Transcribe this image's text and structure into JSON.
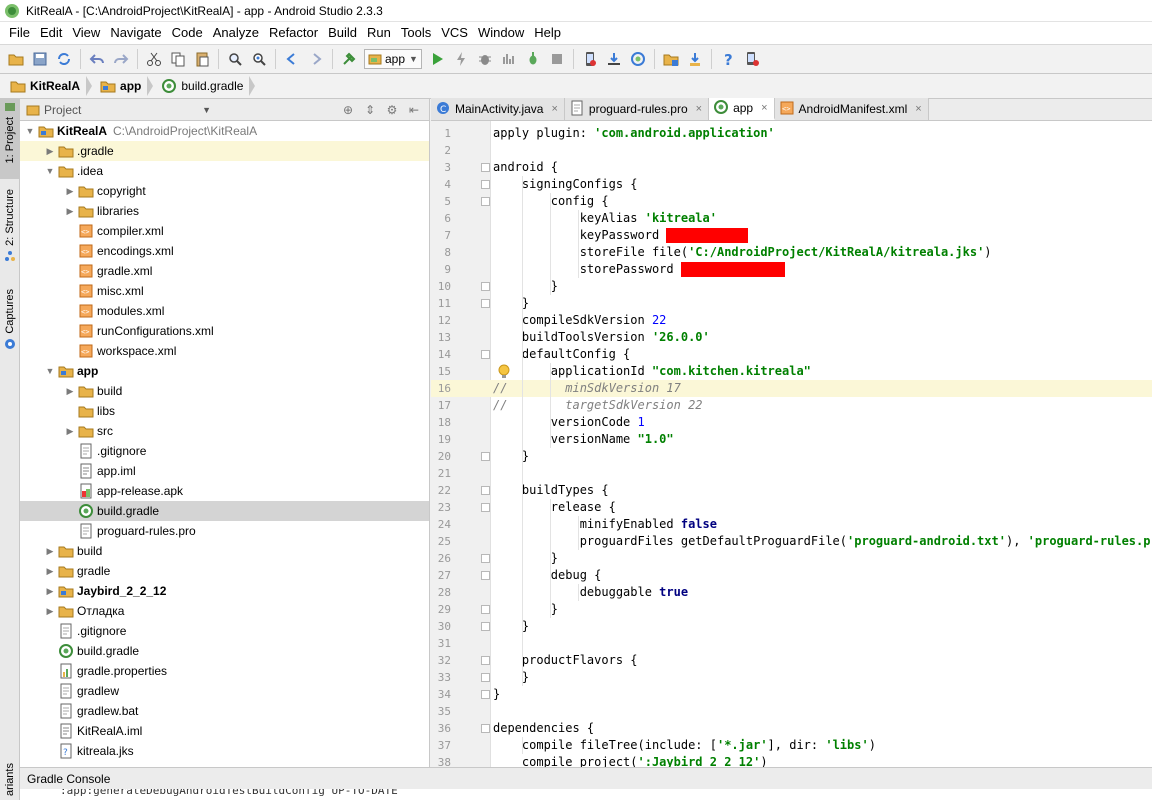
{
  "window": {
    "title": "KitRealA - [C:\\AndroidProject\\KitRealA] - app - Android Studio 2.3.3"
  },
  "menu": [
    "File",
    "Edit",
    "View",
    "Navigate",
    "Code",
    "Analyze",
    "Refactor",
    "Build",
    "Run",
    "Tools",
    "VCS",
    "Window",
    "Help"
  ],
  "toolbar": {
    "run_config": "app"
  },
  "breadcrumb": [
    "KitRealA",
    "app",
    "build.gradle"
  ],
  "sidebar_tabs": [
    "1: Project",
    "2: Structure",
    "Captures"
  ],
  "project_panel": {
    "view_label": "Project",
    "root_name": "KitRealA",
    "root_path": "C:\\AndroidProject\\KitRealA",
    "items": [
      {
        "label": ".gradle",
        "depth": 1,
        "arrow": "right",
        "icon": "folder",
        "highlight": true
      },
      {
        "label": ".idea",
        "depth": 1,
        "arrow": "down",
        "icon": "folder"
      },
      {
        "label": "copyright",
        "depth": 2,
        "arrow": "right",
        "icon": "folder"
      },
      {
        "label": "libraries",
        "depth": 2,
        "arrow": "right",
        "icon": "folder"
      },
      {
        "label": "compiler.xml",
        "depth": 2,
        "icon": "xml"
      },
      {
        "label": "encodings.xml",
        "depth": 2,
        "icon": "xml"
      },
      {
        "label": "gradle.xml",
        "depth": 2,
        "icon": "xml"
      },
      {
        "label": "misc.xml",
        "depth": 2,
        "icon": "xml"
      },
      {
        "label": "modules.xml",
        "depth": 2,
        "icon": "xml"
      },
      {
        "label": "runConfigurations.xml",
        "depth": 2,
        "icon": "xml"
      },
      {
        "label": "workspace.xml",
        "depth": 2,
        "icon": "xml"
      },
      {
        "label": "app",
        "depth": 1,
        "arrow": "down",
        "icon": "module",
        "bold": true
      },
      {
        "label": "build",
        "depth": 2,
        "arrow": "right",
        "icon": "folder"
      },
      {
        "label": "libs",
        "depth": 2,
        "icon": "folder"
      },
      {
        "label": "src",
        "depth": 2,
        "arrow": "right",
        "icon": "folder"
      },
      {
        "label": ".gitignore",
        "depth": 2,
        "icon": "file"
      },
      {
        "label": "app.iml",
        "depth": 2,
        "icon": "iml"
      },
      {
        "label": "app-release.apk",
        "depth": 2,
        "icon": "apk"
      },
      {
        "label": "build.gradle",
        "depth": 2,
        "icon": "gradle",
        "selected": true
      },
      {
        "label": "proguard-rules.pro",
        "depth": 2,
        "icon": "file"
      },
      {
        "label": "build",
        "depth": 1,
        "arrow": "right",
        "icon": "folder"
      },
      {
        "label": "gradle",
        "depth": 1,
        "arrow": "right",
        "icon": "folder"
      },
      {
        "label": "Jaybird_2_2_12",
        "depth": 1,
        "arrow": "right",
        "icon": "module",
        "bold": true
      },
      {
        "label": "Отладка",
        "depth": 1,
        "arrow": "right",
        "icon": "folder"
      },
      {
        "label": ".gitignore",
        "depth": 1,
        "icon": "file"
      },
      {
        "label": "build.gradle",
        "depth": 1,
        "icon": "gradle"
      },
      {
        "label": "gradle.properties",
        "depth": 1,
        "icon": "properties"
      },
      {
        "label": "gradlew",
        "depth": 1,
        "icon": "file"
      },
      {
        "label": "gradlew.bat",
        "depth": 1,
        "icon": "file"
      },
      {
        "label": "KitRealA.iml",
        "depth": 1,
        "icon": "iml"
      },
      {
        "label": "kitreala.jks",
        "depth": 1,
        "icon": "unknown"
      }
    ]
  },
  "editor_tabs": [
    {
      "label": "MainActivity.java",
      "icon": "java"
    },
    {
      "label": "proguard-rules.pro",
      "icon": "file"
    },
    {
      "label": "app",
      "icon": "gradle",
      "active": true
    },
    {
      "label": "AndroidManifest.xml",
      "icon": "xml"
    }
  ],
  "code_lines": [
    {
      "n": "1",
      "html": "apply plugin: <span class='str'>'com.android.application'</span>"
    },
    {
      "n": "2",
      "html": ""
    },
    {
      "n": "3",
      "html": "android {",
      "fold": true
    },
    {
      "n": "4",
      "html": "    signingConfigs {",
      "fold": true
    },
    {
      "n": "5",
      "html": "        config {",
      "fold": true
    },
    {
      "n": "6",
      "html": "            keyAlias <span class='str'>'kitreala'</span>"
    },
    {
      "n": "7",
      "html": "            keyPassword <span class='redact' style='width:82px'></span>"
    },
    {
      "n": "8",
      "html": "            storeFile file(<span class='str'>'C:/AndroidProject/KitRealA/kitreala.jks'</span>)"
    },
    {
      "n": "9",
      "html": "            storePassword <span class='redact' style='width:104px'></span>"
    },
    {
      "n": "10",
      "html": "        }",
      "fold": true
    },
    {
      "n": "11",
      "html": "    }",
      "fold": true
    },
    {
      "n": "12",
      "html": "    compileSdkVersion <span class='num'>22</span>"
    },
    {
      "n": "13",
      "html": "    buildToolsVersion <span class='str'>'26.0.0'</span>"
    },
    {
      "n": "14",
      "html": "    defaultConfig {",
      "fold": true
    },
    {
      "n": "15",
      "html": "        applicationId <span class='str'>\"com.kitchen.kitreala\"</span>"
    },
    {
      "n": "16",
      "html": "<span class='cmt'>//        minSdkVersion 17</span>",
      "cursor": true
    },
    {
      "n": "17",
      "html": "<span class='cmt'>//        targetSdkVersion 22</span>"
    },
    {
      "n": "18",
      "html": "        versionCode <span class='num'>1</span>"
    },
    {
      "n": "19",
      "html": "        versionName <span class='str'>\"1.0\"</span>"
    },
    {
      "n": "20",
      "html": "    }",
      "fold": true
    },
    {
      "n": "21",
      "html": ""
    },
    {
      "n": "22",
      "html": "    buildTypes {",
      "fold": true
    },
    {
      "n": "23",
      "html": "        release {",
      "fold": true
    },
    {
      "n": "24",
      "html": "            minifyEnabled <span class='kw'>false</span>"
    },
    {
      "n": "25",
      "html": "            proguardFiles getDefaultProguardFile(<span class='str'>'proguard-android.txt'</span>), <span class='str'>'proguard-rules.pro'</span>"
    },
    {
      "n": "26",
      "html": "        }",
      "fold": true
    },
    {
      "n": "27",
      "html": "        debug {",
      "fold": true
    },
    {
      "n": "28",
      "html": "            debuggable <span class='kw'>true</span>"
    },
    {
      "n": "29",
      "html": "        }",
      "fold": true
    },
    {
      "n": "30",
      "html": "    }",
      "fold": true
    },
    {
      "n": "31",
      "html": ""
    },
    {
      "n": "32",
      "html": "    productFlavors {",
      "fold": true
    },
    {
      "n": "33",
      "html": "    }",
      "fold": true
    },
    {
      "n": "34",
      "html": "}",
      "fold": true
    },
    {
      "n": "35",
      "html": ""
    },
    {
      "n": "36",
      "html": "dependencies {",
      "fold": true
    },
    {
      "n": "37",
      "html": "    compile fileTree(include: [<span class='str'>'*.jar'</span>], dir: <span class='str'>'libs'</span>)"
    },
    {
      "n": "38",
      "html": "    compile project(<span class='str'>':Jaybird_2_2_12'</span>)"
    }
  ],
  "bottom": {
    "console_label": "Gradle Console",
    "side_label": "ariants",
    "console_text": ":app:generateDebugAndroidTestBuildConfig UP-TO-DATE"
  },
  "colors": {
    "string": "#008000",
    "keyword": "#000080",
    "number": "#0000ff",
    "comment": "#808080",
    "redaction": "#ff0000",
    "selection": "#d4d4d4",
    "highlight": "#fbf7d7"
  }
}
